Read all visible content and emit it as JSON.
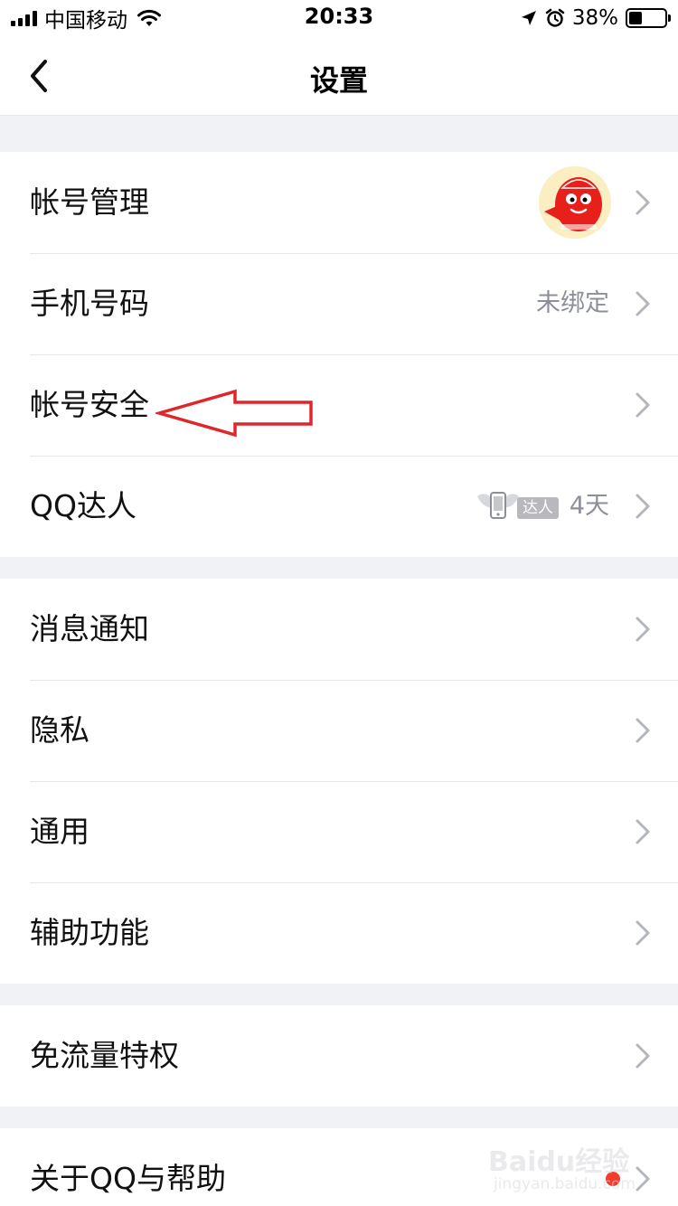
{
  "status_bar": {
    "carrier": "中国移动",
    "time": "20:33",
    "battery_percent": "38%",
    "battery_level": 0.38,
    "icons": [
      "signal-icon",
      "wifi-icon",
      "location-arrow-icon",
      "alarm-icon",
      "battery-icon"
    ]
  },
  "nav": {
    "title": "设置",
    "back_icon": "chevron-left-icon"
  },
  "groups": [
    {
      "items": [
        {
          "label": "帐号管理",
          "accessory": "avatar"
        },
        {
          "label": "手机号码",
          "value": "未绑定"
        },
        {
          "label": "帐号安全",
          "annotation": "red-arrow-pointer"
        },
        {
          "label": "QQ达人",
          "badge": "达人",
          "value": "4天"
        }
      ]
    },
    {
      "items": [
        {
          "label": "消息通知"
        },
        {
          "label": "隐私"
        },
        {
          "label": "通用"
        },
        {
          "label": "辅助功能"
        }
      ]
    },
    {
      "items": [
        {
          "label": "免流量特权"
        }
      ]
    },
    {
      "items": [
        {
          "label": "关于QQ与帮助",
          "has_red_dot": true
        }
      ]
    }
  ],
  "watermark": {
    "main": "Baidu经验",
    "sub": "jingyan.baidu.com"
  },
  "colors": {
    "background": "#f1f2f6",
    "annotation_red": "#e0252b",
    "badge_dot": "#f33b2e",
    "secondary_text": "#8c8f99"
  }
}
